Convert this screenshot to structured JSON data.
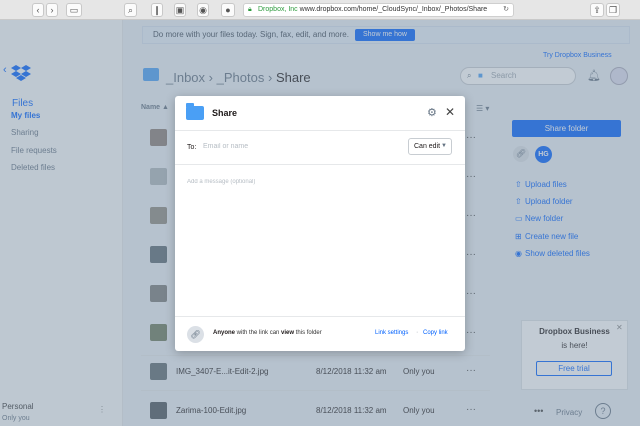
{
  "browser": {
    "url_secure_label": "Dropbox, Inc",
    "url_text": "www.dropbox.com/home/_CloudSync/_Inbox/_Photos/Share"
  },
  "sidebar": {
    "title": "Files",
    "items": [
      {
        "label": "My files",
        "active": true
      },
      {
        "label": "Sharing"
      },
      {
        "label": "File requests"
      },
      {
        "label": "Deleted files"
      }
    ],
    "account_name": "Personal",
    "account_sub": "Only you"
  },
  "banner": {
    "text": "Do more with your files today. Sign, fax, edit, and more.",
    "button": "Show me how"
  },
  "header": {
    "try_business": "Try Dropbox Business",
    "breadcrumb": [
      "_Inbox",
      "_Photos",
      "Share"
    ],
    "breadcrumb_sep": "›",
    "search_placeholder": "Search"
  },
  "table": {
    "col_name": "Name",
    "col_sort": "▲",
    "rows": [
      {
        "name": "IMG_3407-E...it-Edit-2.jpg",
        "modified": "8/12/2018 11:32 am",
        "members": "Only you"
      },
      {
        "name": "Zarima-100-Edit.jpg",
        "modified": "8/12/2018 11:32 am",
        "members": "Only you"
      }
    ]
  },
  "right_panel": {
    "share_folder": "Share folder",
    "member_initials": "HG",
    "actions": [
      "Upload files",
      "Upload folder",
      "New folder",
      "Create new file",
      "Show deleted files"
    ]
  },
  "promo": {
    "title": "Dropbox Business",
    "subtitle": "is here!",
    "button": "Free trial"
  },
  "footer": {
    "more": "•••",
    "privacy": "Privacy",
    "help": "?"
  },
  "modal": {
    "title": "Share",
    "to_label": "To:",
    "email_placeholder": "Email or name",
    "permission": "Can edit",
    "message_placeholder": "Add a message (optional)",
    "footer_bold1": "Anyone",
    "footer_mid": " with the link can ",
    "footer_bold2": "view",
    "footer_end": " this folder",
    "link_settings": "Link settings",
    "dot": "·",
    "copy_link": "Copy link"
  },
  "colors": {
    "accent": "#0061fe",
    "folder": "#4a9ff5",
    "secure": "#2e9b3e"
  }
}
